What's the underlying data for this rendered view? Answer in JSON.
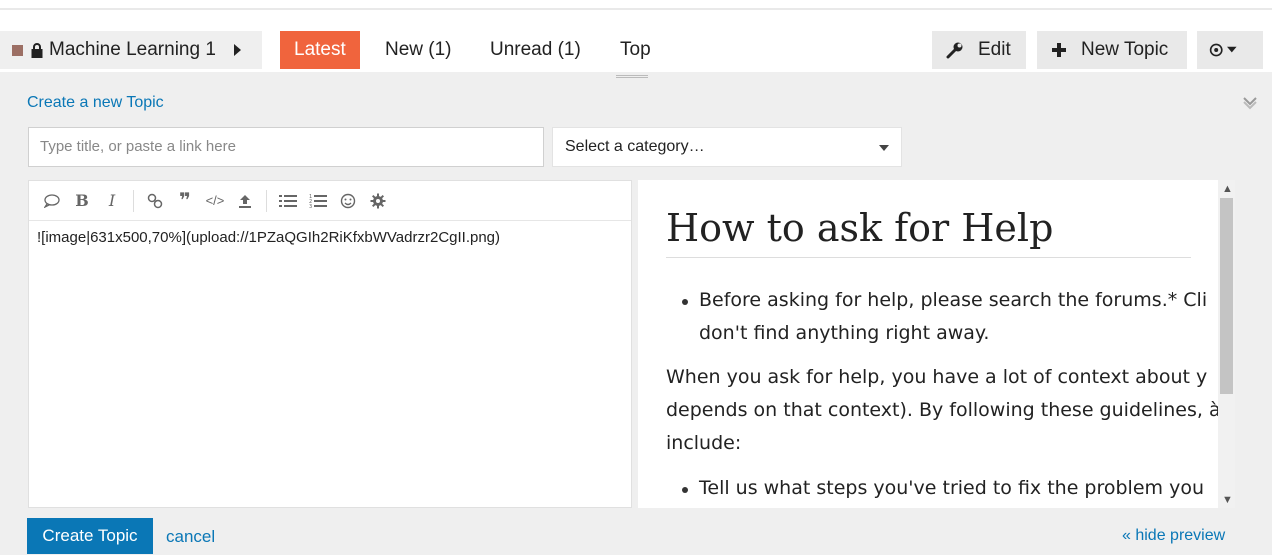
{
  "navbar": {
    "category": "Machine Learning 1",
    "tabs": [
      {
        "label": "Latest",
        "active": true
      },
      {
        "label": "New (1)"
      },
      {
        "label": "Unread (1)"
      },
      {
        "label": "Top"
      }
    ],
    "edit_label": "Edit",
    "new_topic_label": "New Topic",
    "icons": [
      "lock-icon",
      "caret-right-icon",
      "wrench-icon",
      "plus-icon",
      "notification-icon",
      "chevron-down-icon"
    ]
  },
  "composer": {
    "create_link": "Create a new Topic",
    "title_placeholder": "Type title, or paste a link here",
    "category_placeholder": "Select a category…",
    "toolbar_icons": [
      "quote-icon",
      "bold-icon",
      "italic-icon",
      "link-icon",
      "blockquote-icon",
      "code-icon",
      "upload-icon",
      "bullet-list-icon",
      "numbered-list-icon",
      "emoji-icon",
      "settings-icon"
    ],
    "editor_text": "![image|631x500,70%](upload://1PZaQGIh2RiKfxbWVadrzr2CgII.png)",
    "create_button": "Create Topic",
    "cancel": "cancel",
    "hide_preview": "« hide preview"
  },
  "preview": {
    "title": "How to ask for Help",
    "bullet1_line1": "Before asking for help, please search the forums.* Cli",
    "bullet1_line2": "don't find anything right away.",
    "para_line1": "When you ask for help, you have a lot of context about y",
    "para_line2": "depends on that context). By following these guidelines, à",
    "para_line3": "include:",
    "bullet2_line1": "Tell us what steps you've tried to fix the problem you"
  },
  "colors": {
    "accent": "#f0643d",
    "link": "#0a77b6",
    "primary_button": "#0a77b6"
  }
}
